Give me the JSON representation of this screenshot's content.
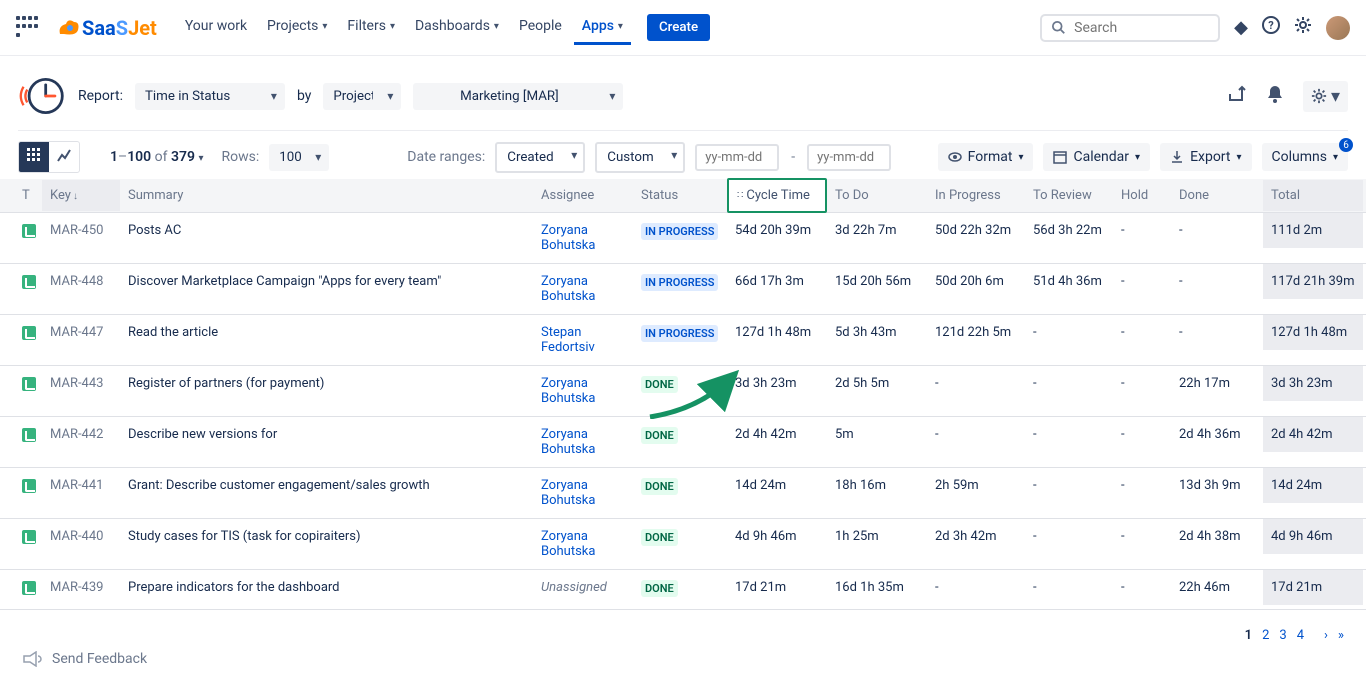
{
  "nav": {
    "items": [
      {
        "label": "Your work",
        "hasDropdown": false
      },
      {
        "label": "Projects",
        "hasDropdown": true
      },
      {
        "label": "Filters",
        "hasDropdown": true
      },
      {
        "label": "Dashboards",
        "hasDropdown": true
      },
      {
        "label": "People",
        "hasDropdown": false
      },
      {
        "label": "Apps",
        "hasDropdown": true,
        "active": true
      }
    ],
    "create": "Create",
    "searchPlaceholder": "Search",
    "logo": {
      "s1": "Saa",
      "s2": "S",
      "s3": "Jet"
    }
  },
  "sub": {
    "reportLabel": "Report:",
    "reportValue": "Time in Status",
    "byLabel": "by",
    "byValue": "Project",
    "projectValue": "Marketing [MAR]"
  },
  "toolbar": {
    "rangeFrom": "1",
    "rangeTo": "100",
    "total": "379",
    "sep": "–",
    "of": "of",
    "rowsLabel": "Rows:",
    "rowsValue": "100",
    "dateRangesLabel": "Date ranges:",
    "dateRangeType": "Created",
    "dateRangeCustom": "Custom",
    "datePlaceholder": "yy-mm-dd",
    "format": "Format",
    "calendar": "Calendar",
    "export": "Export",
    "columns": "Columns",
    "columnsBadge": "6"
  },
  "cols": {
    "t": "T",
    "key": "Key",
    "summary": "Summary",
    "assignee": "Assignee",
    "status": "Status",
    "cycle": "Cycle Time",
    "todo": "To Do",
    "inprogress": "In Progress",
    "toreview": "To Review",
    "hold": "Hold",
    "done": "Done",
    "total": "Total"
  },
  "rows": [
    {
      "key": "MAR-450",
      "summary": "Posts AC",
      "assignee": "Zoryana Bohutska",
      "status": "IN PROGRESS",
      "statusClass": "INPROGRESS",
      "cycle": "54d 20h 39m",
      "todo": "3d 22h 7m",
      "prog": "50d 22h 32m",
      "rev": "56d 3h 22m",
      "hold": "-",
      "done": "-",
      "total": "111d 2m"
    },
    {
      "key": "MAR-448",
      "summary": "Discover Marketplace Campaign \"Apps for every team\"",
      "assignee": "Zoryana Bohutska",
      "status": "IN PROGRESS",
      "statusClass": "INPROGRESS",
      "cycle": "66d 17h 3m",
      "todo": "15d 20h 56m",
      "prog": "50d 20h 6m",
      "rev": "51d 4h 36m",
      "hold": "-",
      "done": "-",
      "total": "117d 21h 39m"
    },
    {
      "key": "MAR-447",
      "summary": "Read the article",
      "assignee": "Stepan Fedortsiv",
      "status": "IN PROGRESS",
      "statusClass": "INPROGRESS",
      "cycle": "127d 1h 48m",
      "todo": "5d 3h 43m",
      "prog": "121d 22h 5m",
      "rev": "-",
      "hold": "-",
      "done": "-",
      "total": "127d 1h 48m"
    },
    {
      "key": "MAR-443",
      "summary": "Register of partners (for payment)",
      "assignee": "Zoryana Bohutska",
      "status": "DONE",
      "statusClass": "DONE",
      "cycle": "3d 3h 23m",
      "todo": "2d 5h 5m",
      "prog": "-",
      "rev": "-",
      "hold": "-",
      "done": "22h 17m",
      "total": "3d 3h 23m"
    },
    {
      "key": "MAR-442",
      "summary": "Describe new versions for",
      "assignee": "Zoryana Bohutska",
      "status": "DONE",
      "statusClass": "DONE",
      "cycle": "2d 4h 42m",
      "todo": "5m",
      "prog": "-",
      "rev": "-",
      "hold": "-",
      "done": "2d 4h 36m",
      "total": "2d 4h 42m"
    },
    {
      "key": "MAR-441",
      "summary": "Grant: Describe customer engagement/sales growth",
      "assignee": "Zoryana Bohutska",
      "status": "DONE",
      "statusClass": "DONE",
      "cycle": "14d 24m",
      "todo": "18h 16m",
      "prog": "2h 59m",
      "rev": "-",
      "hold": "-",
      "done": "13d 3h 9m",
      "total": "14d 24m"
    },
    {
      "key": "MAR-440",
      "summary": "Study cases for TIS (task for copiraiters)",
      "assignee": "Zoryana Bohutska",
      "status": "DONE",
      "statusClass": "DONE",
      "cycle": "4d 9h 46m",
      "todo": "1h 25m",
      "prog": "2d 3h 42m",
      "rev": "-",
      "hold": "-",
      "done": "2d 4h 38m",
      "total": "4d 9h 46m"
    },
    {
      "key": "MAR-439",
      "summary": "Prepare indicators for the dashboard",
      "assignee": "",
      "unassigned": true,
      "status": "DONE",
      "statusClass": "DONE",
      "cycle": "17d 21m",
      "todo": "16d 1h 35m",
      "prog": "-",
      "rev": "-",
      "hold": "-",
      "done": "22h 46m",
      "total": "17d 21m"
    }
  ],
  "pagination": {
    "current": "1",
    "pages": [
      "2",
      "3",
      "4"
    ],
    "next": "›",
    "last": "»"
  },
  "feedback": "Send Feedback",
  "unassignedLabel": "Unassigned"
}
